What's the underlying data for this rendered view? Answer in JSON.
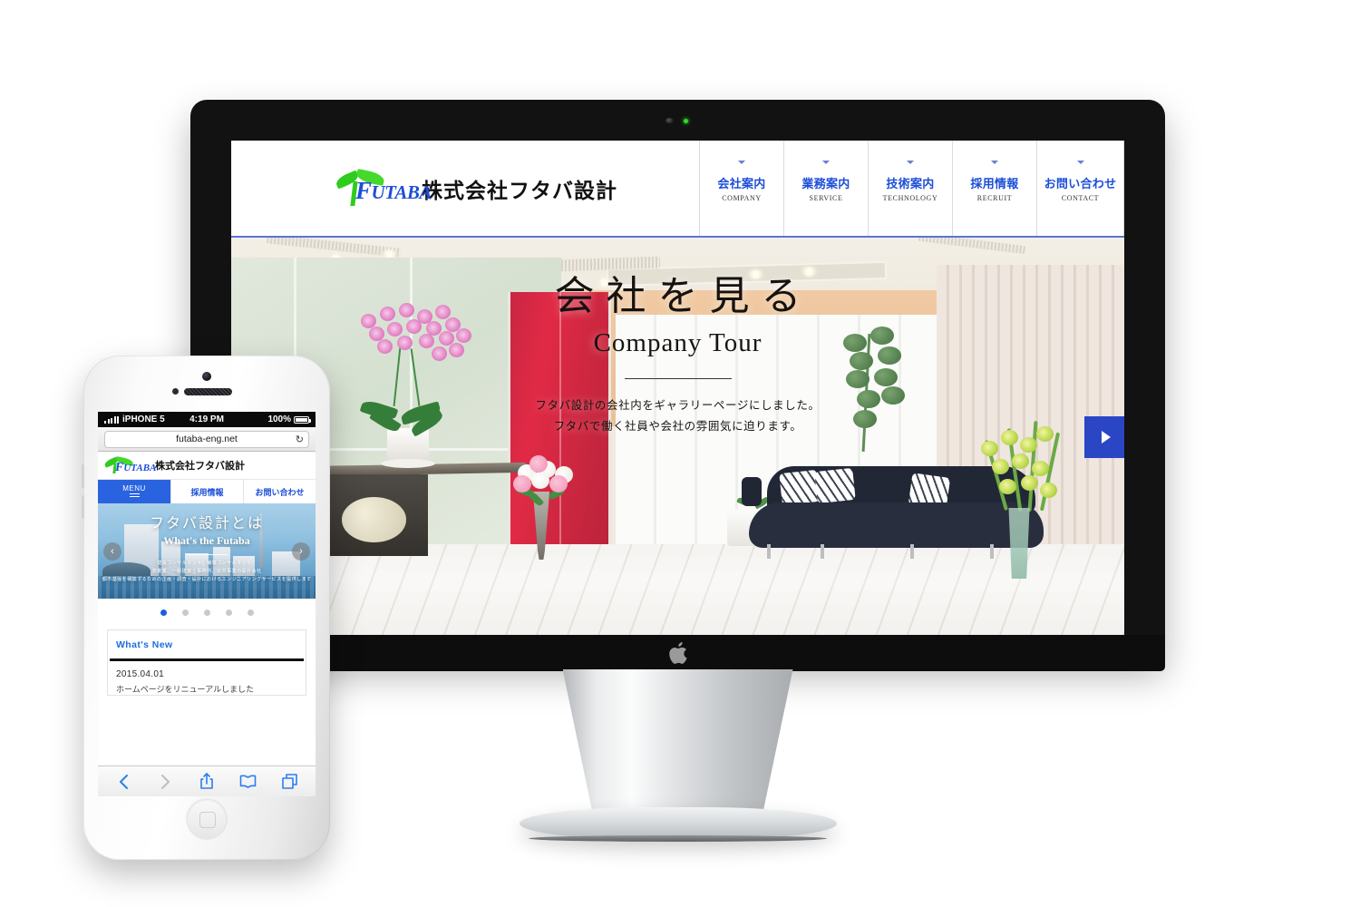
{
  "desktop": {
    "brand": {
      "logo_word": "FUTABA",
      "logo_word_cap": "F",
      "logo_word_rest": "UTABA",
      "company_name": "株式会社フタバ設計",
      "logo_icon": "sprout-logo-icon"
    },
    "nav": [
      {
        "ja": "会社案内",
        "en": "COMPANY"
      },
      {
        "ja": "業務案内",
        "en": "SERVICE"
      },
      {
        "ja": "技術案内",
        "en": "TECHNOLOGY"
      },
      {
        "ja": "採用情報",
        "en": "RECRUIT"
      },
      {
        "ja": "お問い合わせ",
        "en": "CONTACT"
      }
    ],
    "hero": {
      "title_ja": "会社を見る",
      "title_en": "Company Tour",
      "sub_line1": "フタバ設計の会社内をギャラリーページにしました。",
      "sub_line2": "フタバで働く社員や会社の雰囲気に迫ります。",
      "next_label": "▶"
    }
  },
  "phone": {
    "status": {
      "carrier": "iPHONE 5",
      "time": "4:19 PM",
      "battery": "100%"
    },
    "browser": {
      "url": "futaba-eng.net",
      "reload_label": "↻"
    },
    "header": {
      "logo_word_cap": "F",
      "logo_word_rest": "UTABA",
      "company_name": "株式会社フタバ設計"
    },
    "nav": {
      "menu_label": "MENU",
      "items": [
        "採用情報",
        "お問い合わせ"
      ]
    },
    "slider": {
      "title_ja": "フタバ設計とは",
      "title_en": "What's the Futaba",
      "sub_line1": "建設コンサルタント、補償コンサルタント、",
      "sub_line2": "測量業、一級建築士事務所、公共事業の設計会社",
      "sub_line3": "都市基盤を構築するための企画・調査・設計におけるエンジニアリングサービスを提供します",
      "prev_label": "‹",
      "next_label": "›",
      "dots": 5,
      "active_dot": 0
    },
    "news": {
      "title": "What's New",
      "date": "2015.04.01",
      "headline": "ホームページをリニューアルしました"
    },
    "toolbar": [
      "back-icon",
      "forward-icon",
      "share-icon",
      "bookmarks-icon",
      "tabs-icon"
    ]
  },
  "colors": {
    "brand_blue": "#1c4ed8",
    "accent_blue": "#2a46c4",
    "phone_blue": "#2a63e0",
    "logo_green": "#2ecc1d"
  }
}
